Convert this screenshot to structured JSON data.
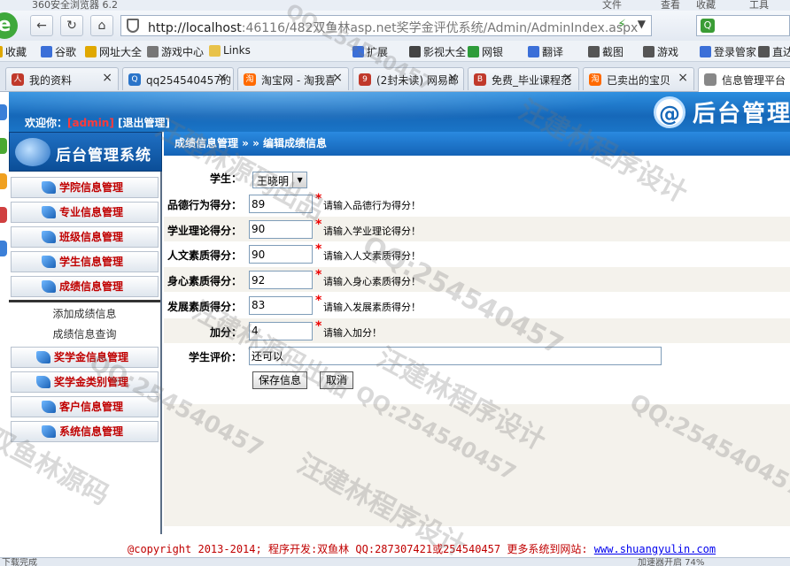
{
  "browser": {
    "title": "360安全浏览器 6.2",
    "menu": [
      "文件",
      "查看",
      "收藏",
      "工具"
    ],
    "address_host": "http://localhost",
    "address_path": ":46116/482双鱼林asp.net奖学金评优系统/Admin/AdminIndex.aspx",
    "search_icon_label": "Q"
  },
  "favorites": [
    {
      "label": "收藏",
      "icon": "star-icon",
      "color": "#e0a800"
    },
    {
      "label": "谷歌",
      "icon": "google-icon",
      "color": "#3b6fd8"
    },
    {
      "label": "网址大全",
      "icon": "globe-icon",
      "color": "#e0a800"
    },
    {
      "label": "游戏中心",
      "icon": "gamepad-icon",
      "color": "#777777"
    },
    {
      "label": "Links",
      "icon": "folder-icon",
      "color": "#e8c24a"
    },
    {
      "label": "扩展",
      "icon": "puzzle-icon",
      "color": "#3b6fd8"
    },
    {
      "label": "影视大全",
      "icon": "video-icon",
      "color": "#444444"
    },
    {
      "label": "网银",
      "icon": "bank-icon",
      "color": "#2e9c3a"
    },
    {
      "label": "翻译",
      "icon": "translate-icon",
      "color": "#3b6fd8"
    },
    {
      "label": "截图",
      "icon": "scissors-icon",
      "color": "#555555"
    },
    {
      "label": "游戏",
      "icon": "gamepad-icon",
      "color": "#555555"
    },
    {
      "label": "登录管家",
      "icon": "key-icon",
      "color": "#3b6fd8"
    },
    {
      "label": "直达",
      "icon": "arrow-icon",
      "color": "#555555"
    }
  ],
  "tabs": [
    {
      "label": "我的资料",
      "icon_color": "#c0392b",
      "icon_text": "人"
    },
    {
      "label": "qq254540457的",
      "icon_color": "#2a74c9",
      "icon_text": "Q"
    },
    {
      "label": "淘宝网 - 淘我喜",
      "icon_color": "#ff6a00",
      "icon_text": "淘"
    },
    {
      "label": "(2封未读) 网易邮",
      "icon_color": "#c0392b",
      "icon_text": "9"
    },
    {
      "label": "免费_毕业课程范",
      "icon_color": "#c0392b",
      "icon_text": "B"
    },
    {
      "label": "已卖出的宝贝",
      "icon_color": "#ff6a00",
      "icon_text": "淘"
    },
    {
      "label": "信息管理平台",
      "icon_color": "#888888",
      "icon_text": ""
    }
  ],
  "header": {
    "welcome_prefix": "欢迎你：",
    "username": "[admin]",
    "logout": "[退出管理]",
    "brand_mark": "@",
    "brand_text": "后台管理"
  },
  "sidebar": {
    "title": "后台管理系统",
    "items_top": [
      "学院信息管理",
      "专业信息管理",
      "班级信息管理",
      "学生信息管理",
      "成绩信息管理"
    ],
    "sub_items": [
      "添加成绩信息",
      "成绩信息查询"
    ],
    "items_bottom": [
      "奖学金信息管理",
      "奖学金类别管理",
      "客户信息管理",
      "系统信息管理"
    ]
  },
  "breadcrumb": "成绩信息管理 » » 编辑成绩信息",
  "form": {
    "student_label": "学生：",
    "student_value": "王晓明",
    "fields": [
      {
        "label": "品德行为得分：",
        "value": "89",
        "hint": "请输入品德行为得分！"
      },
      {
        "label": "学业理论得分：",
        "value": "90",
        "hint": "请输入学业理论得分！"
      },
      {
        "label": "人文素质得分：",
        "value": "90",
        "hint": "请输入人文素质得分！"
      },
      {
        "label": "身心素质得分：",
        "value": "92",
        "hint": "请输入身心素质得分！"
      },
      {
        "label": "发展素质得分：",
        "value": "83",
        "hint": "请输入发展素质得分！"
      },
      {
        "label": "加分：",
        "value": "4",
        "hint": "请输入加分！"
      }
    ],
    "comment_label": "学生评价：",
    "comment_value": "还可以",
    "save_button": "保存信息",
    "cancel_button": "取消"
  },
  "footer": {
    "text": "@copyright 2013-2014; 程序开发:双鱼林  QQ:287307421或254540457  更多系统到网站: ",
    "site": "www.shuangyulin.com"
  },
  "statusbar": {
    "left": "下载完成",
    "right": "加速器开启  74%"
  },
  "watermarks": [
    "QQ:254540457",
    "汪建林程序设计",
    "汪建林源码出品",
    "双鱼林源码"
  ]
}
